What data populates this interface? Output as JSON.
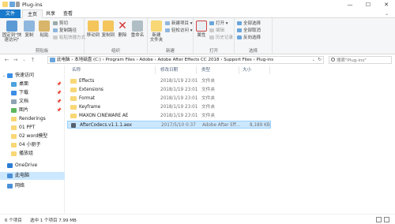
{
  "window": {
    "title": "Plug-ins",
    "minimize": "—",
    "maximize": "☐",
    "close": "✕"
  },
  "tabs": {
    "file": "文件",
    "home": "主页",
    "share": "共享",
    "view": "查看"
  },
  "ribbon": {
    "clipboard": {
      "group": "剪贴板",
      "pin_quick": "固定到\"快速访问\"",
      "copy": "复制",
      "paste": "粘贴",
      "cut": "剪切",
      "copy_path": "复制路径",
      "paste_shortcut": "粘贴快捷方式"
    },
    "organize": {
      "group": "组织",
      "move_to": "移动到",
      "copy_to": "复制到",
      "delete": "删除",
      "rename": "重命名"
    },
    "new": {
      "group": "新建",
      "new_folder": "新建\n文件夹",
      "new_item": "新建项目 ▾",
      "easy_access": "轻松访问 ▾"
    },
    "open": {
      "group": "打开",
      "properties": "属性",
      "open": "打开 ▾",
      "edit": "编辑",
      "history": "历史记录"
    },
    "select": {
      "group": "选择",
      "select_all": "全部选择",
      "select_none": "全部取消",
      "invert": "反向选择"
    }
  },
  "address": {
    "crumbs": [
      "此电脑",
      "本地磁盘 (C:)",
      "Program Files",
      "Adobe",
      "Adobe After Effects CC 2018",
      "Support Files",
      "Plug-ins"
    ],
    "search_placeholder": "搜索\"Plug-ins\""
  },
  "nav": {
    "quick_access": "快速访问",
    "items": [
      "桌面",
      "下载",
      "文档",
      "图片",
      "Renderings",
      "01 PPT",
      "02 word模型",
      "04 小册子",
      "播放组"
    ],
    "onedrive": "OneDrive",
    "this_pc": "此电脑",
    "network": "网络"
  },
  "columns": {
    "name": "名称",
    "date": "修改日期",
    "type": "类型",
    "size": "大小"
  },
  "files": [
    {
      "name": "Effects",
      "date": "2018/1/19 23:01",
      "type": "文件夹",
      "size": ""
    },
    {
      "name": "Extensions",
      "date": "2018/1/19 23:01",
      "type": "文件夹",
      "size": ""
    },
    {
      "name": "Format",
      "date": "2018/1/19 23:01",
      "type": "文件夹",
      "size": ""
    },
    {
      "name": "Keyframe",
      "date": "2018/1/19 23:01",
      "type": "文件夹",
      "size": ""
    },
    {
      "name": "MAXON CINEWARE AE",
      "date": "2018/1/19 23:01",
      "type": "文件夹",
      "size": ""
    },
    {
      "name": "AfterCodecs.v1.1.1.aex",
      "date": "2017/5/10 0:37",
      "type": "Adobe After Eff...",
      "size": "8,189 KB"
    }
  ],
  "status": {
    "count": "6 个项目",
    "selected": "选中 1 个项目  7.99 MB"
  },
  "colors": {
    "accent": "#1979ca",
    "selection": "#cce8ff",
    "folder": "#f8d775"
  }
}
